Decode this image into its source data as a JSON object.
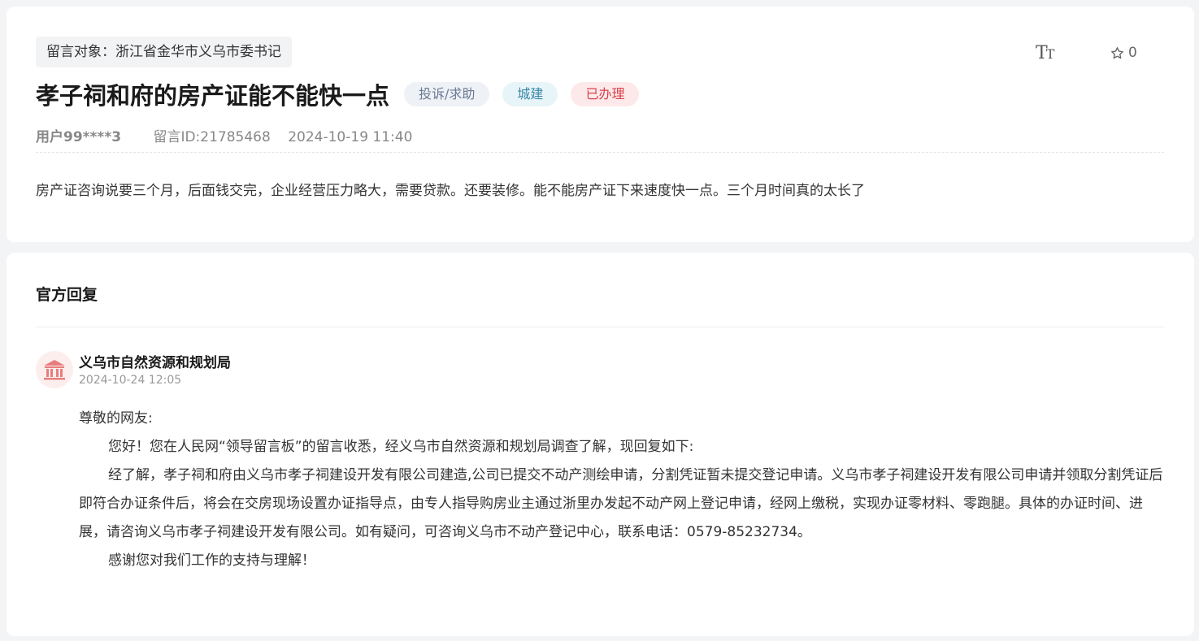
{
  "message": {
    "target": "留言对象：浙江省金华市义乌市委书记",
    "title": "孝子祠和府的房产证能不能快一点",
    "tags": {
      "type": "投诉/求助",
      "category": "城建",
      "status": "已办理"
    },
    "user": "用户99****3",
    "message_id": "留言ID:21785468",
    "datetime": "2024-10-19 11:40",
    "content": "房产证咨询说要三个月，后面钱交完，企业经营压力略大，需要贷款。还要装修。能不能房产证下来速度快一点。三个月时间真的太长了",
    "font_size_icon": "font-size-icon",
    "favorite_icon": "star-icon",
    "favorite_count": "0"
  },
  "reply": {
    "heading": "官方回复",
    "department": "义乌市自然资源和规划局",
    "department_icon": "government-building-icon",
    "datetime": "2024-10-24 12:05",
    "greeting": "尊敬的网友:",
    "paragraphs": [
      "您好！您在人民网“领导留言板”的留言收悉，经义乌市自然资源和规划局调查了解，现回复如下:",
      "经了解，孝子祠和府由义乌市孝子祠建设开发有限公司建造,公司已提交不动产测绘申请，分割凭证暂未提交登记申请。义乌市孝子祠建设开发有限公司申请并领取分割凭证后即符合办证条件后，将会在交房现场设置办证指导点，由专人指导购房业主通过浙里办发起不动产网上登记申请，经网上缴税，实现办证零材料、零跑腿。具体的办证时间、进展，请咨询义乌市孝子祠建设开发有限公司。如有疑问，可咨询义乌市不动产登记中心，联系电话：0579-85232734。",
      "感谢您对我们工作的支持与理解！"
    ]
  },
  "colors": {
    "page_bg": "#f3f4f6",
    "card_bg": "#ffffff",
    "badge_type_bg": "#eef1f6",
    "badge_category_bg": "#e8f5f8",
    "badge_status_bg": "#fde9ea",
    "badge_status_text": "#d9434c",
    "avatar_accent": "#e87d7d"
  }
}
